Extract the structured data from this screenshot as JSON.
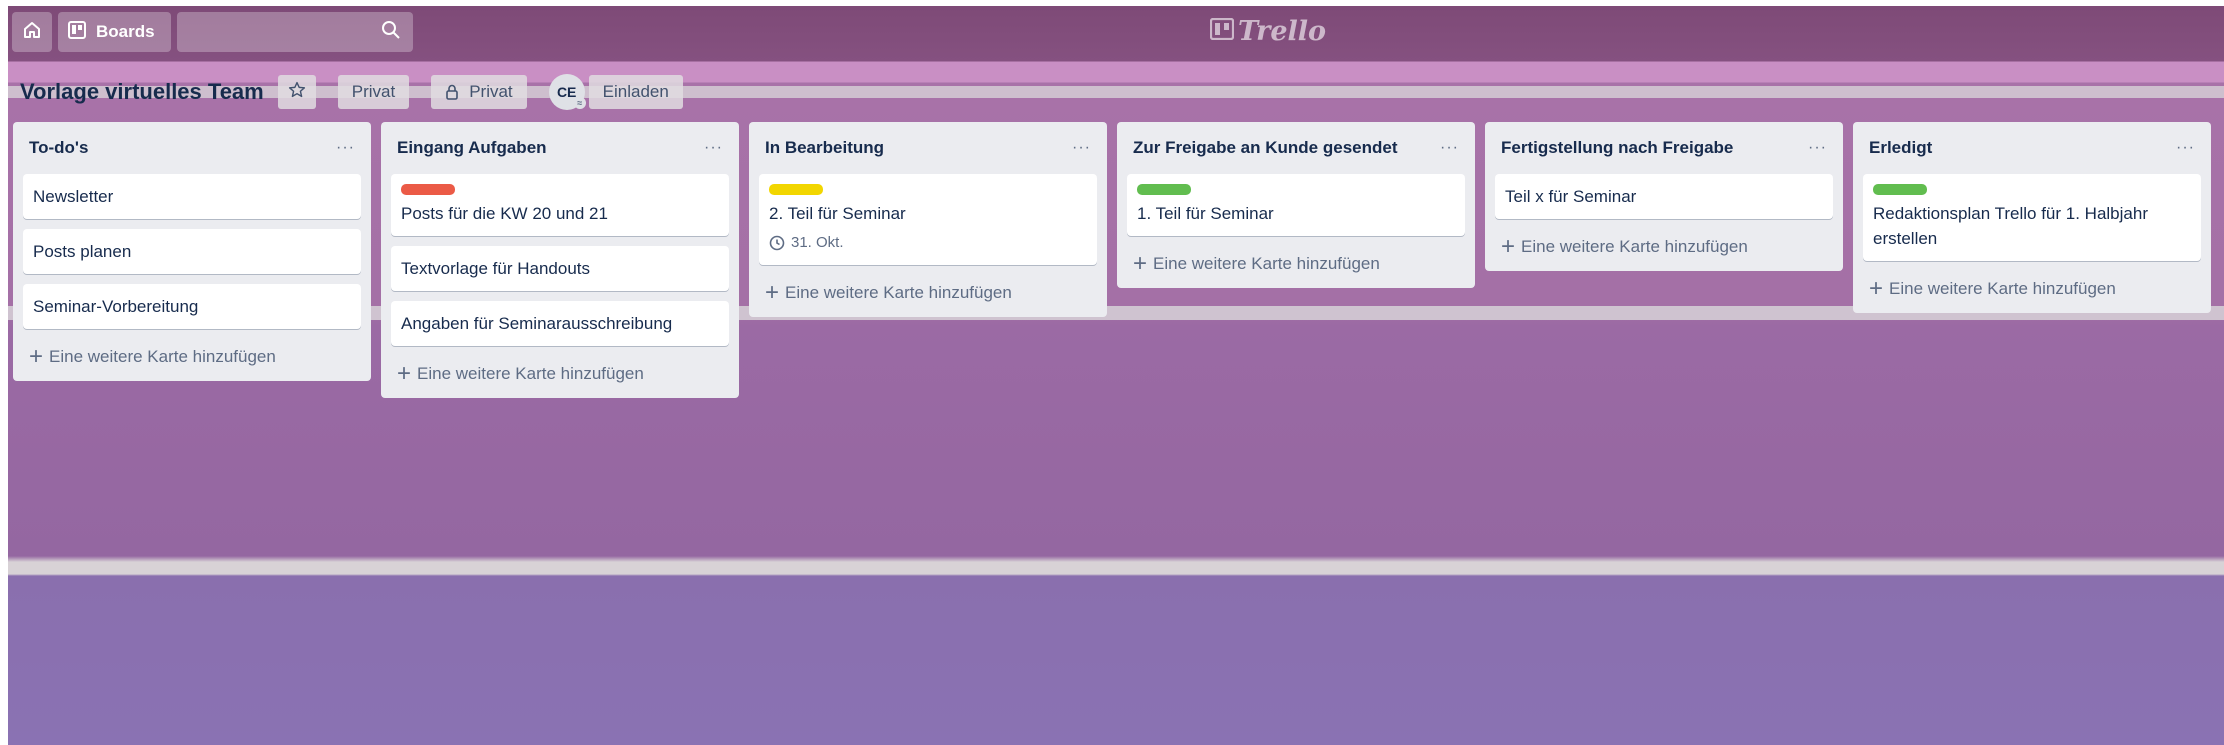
{
  "header": {
    "boards_label": "Boards",
    "search_placeholder": "",
    "logo_text": "Trello"
  },
  "board": {
    "title": "Vorlage virtuelles Team",
    "visibility_label": "Privat",
    "private_label": "Privat",
    "member_initials": "CE",
    "invite_label": "Einladen"
  },
  "lists": [
    {
      "title": "To-do's",
      "menu": "···",
      "cards": [
        {
          "text": "Newsletter"
        },
        {
          "text": "Posts planen"
        },
        {
          "text": "Seminar-Vorbereitung"
        }
      ],
      "add_label": "Eine weitere Karte hinzufügen"
    },
    {
      "title": "Eingang Aufgaben",
      "menu": "···",
      "cards": [
        {
          "text": "Posts für die KW 20 und 21",
          "label_color": "#eb5a46"
        },
        {
          "text": "Textvorlage für Handouts"
        },
        {
          "text": "Angaben für Seminarausschreibung"
        }
      ],
      "add_label": "Eine weitere Karte hinzufügen"
    },
    {
      "title": "In Bearbeitung",
      "menu": "···",
      "cards": [
        {
          "text": "2. Teil für Seminar",
          "label_color": "#f2d600",
          "due": "31. Okt."
        }
      ],
      "add_label": "Eine weitere Karte hinzufügen"
    },
    {
      "title": "Zur Freigabe an Kunde gesendet",
      "menu": "···",
      "cards": [
        {
          "text": "1. Teil für Seminar",
          "label_color": "#61bd4f"
        }
      ],
      "add_label": "Eine weitere Karte hinzufügen"
    },
    {
      "title": "Fertigstellung nach Freigabe",
      "menu": "···",
      "cards": [
        {
          "text": "Teil x für Seminar"
        }
      ],
      "add_label": "Eine weitere Karte hinzufügen"
    },
    {
      "title": "Erledigt",
      "menu": "···",
      "cards": [
        {
          "text": "Redaktionsplan Trello für 1. Halbjahr erstellen",
          "label_color": "#61bd4f"
        }
      ],
      "add_label": "Eine weitere Karte hinzufügen"
    }
  ]
}
